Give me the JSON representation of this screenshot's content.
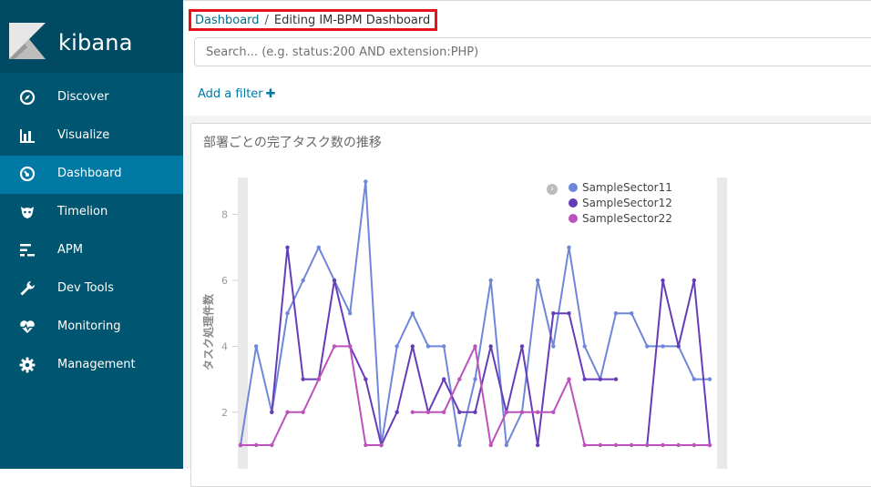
{
  "brand": {
    "name": "kibana"
  },
  "sidebar": {
    "items": [
      {
        "label": "Discover",
        "icon": "compass-icon"
      },
      {
        "label": "Visualize",
        "icon": "bar-chart-icon"
      },
      {
        "label": "Dashboard",
        "icon": "dashboard-icon",
        "active": true
      },
      {
        "label": "Timelion",
        "icon": "timelion-icon"
      },
      {
        "label": "APM",
        "icon": "apm-icon"
      },
      {
        "label": "Dev Tools",
        "icon": "wrench-icon"
      },
      {
        "label": "Monitoring",
        "icon": "heartbeat-icon"
      },
      {
        "label": "Management",
        "icon": "gear-icon"
      }
    ]
  },
  "breadcrumb": {
    "root": "Dashboard",
    "separator": "/",
    "current": "Editing IM-BPM Dashboard"
  },
  "search": {
    "placeholder": "Search... (e.g. status:200 AND extension:PHP)",
    "value": ""
  },
  "filter_bar": {
    "add_label": "Add a filter",
    "add_icon": "plus-icon"
  },
  "panel": {
    "title": "部署ごとの完了タスク数の推移"
  },
  "colors": {
    "sidebar": "#005571",
    "active": "#0079a5",
    "highlight": "#e8101c",
    "series1": "#6f87d8",
    "series2": "#663db8",
    "series3": "#bc52bc"
  },
  "chart_data": {
    "type": "line",
    "title": "",
    "xlabel": "",
    "ylabel": "タスク処理件数",
    "ylim": [
      0.9,
      9.1
    ],
    "yticks": [
      2,
      4,
      6,
      8
    ],
    "grid": false,
    "legend": "right",
    "x": [
      0,
      1,
      2,
      3,
      4,
      5,
      6,
      7,
      8,
      9,
      10,
      11,
      12,
      13,
      14,
      15,
      16,
      17,
      18,
      19,
      20,
      21,
      22,
      23,
      24,
      25,
      26,
      27,
      28,
      29,
      30
    ],
    "series": [
      {
        "name": "SampleSector11",
        "color": "#6f87d8",
        "values": [
          1,
          4,
          2,
          5,
          6,
          7,
          6,
          5,
          9,
          1,
          4,
          5,
          4,
          4,
          1,
          3,
          6,
          1,
          2,
          6,
          4,
          7,
          4,
          3,
          5,
          5,
          4,
          4,
          4,
          3,
          3
        ]
      },
      {
        "name": "SampleSector12",
        "color": "#663db8",
        "values": [
          1,
          null,
          2,
          7,
          3,
          3,
          6,
          4,
          3,
          1,
          2,
          4,
          2,
          3,
          2,
          2,
          4,
          2,
          4,
          1,
          5,
          5,
          3,
          3,
          3,
          null,
          1,
          6,
          4,
          6,
          1
        ]
      },
      {
        "name": "SampleSector22",
        "color": "#bc52bc",
        "values": [
          1,
          1,
          1,
          2,
          2,
          3,
          4,
          4,
          1,
          1,
          null,
          2,
          2,
          2,
          3,
          4,
          1,
          2,
          2,
          2,
          2,
          3,
          1,
          1,
          1,
          1,
          1,
          1,
          1,
          1,
          1
        ]
      }
    ]
  }
}
